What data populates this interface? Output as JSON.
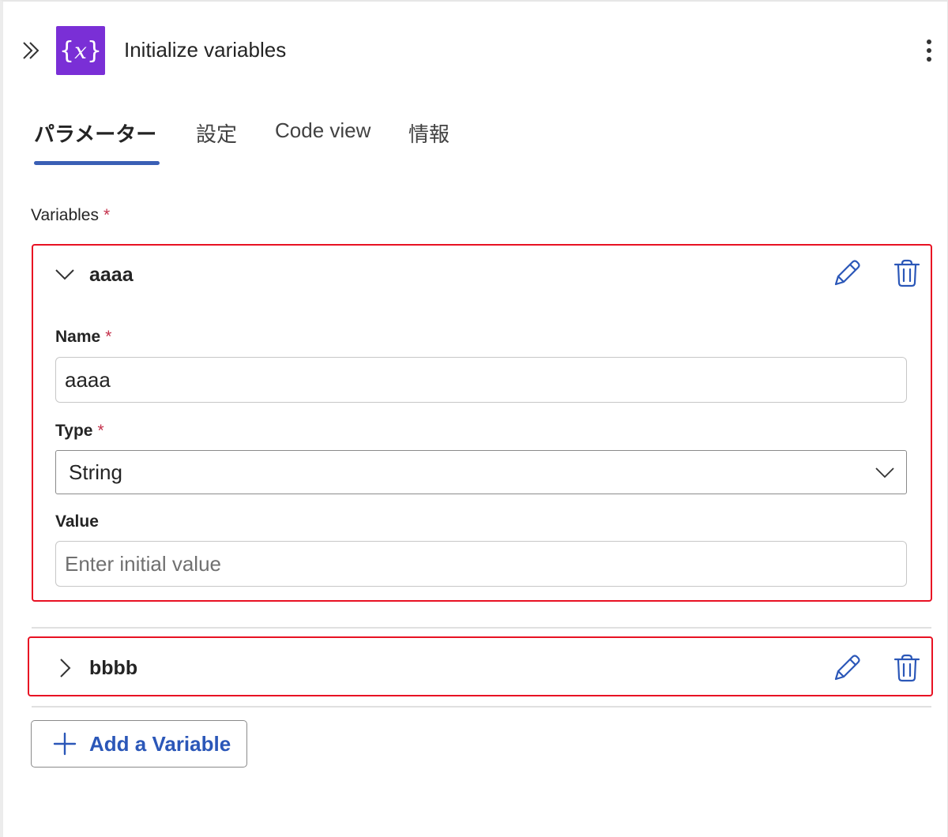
{
  "header": {
    "title": "Initialize variables",
    "icon_text": "x"
  },
  "tabs": [
    {
      "label": "パラメーター",
      "active": true
    },
    {
      "label": "設定",
      "active": false
    },
    {
      "label": "Code view",
      "active": false
    },
    {
      "label": "情報",
      "active": false
    }
  ],
  "variables_section": {
    "label": "Variables",
    "required_mark": "*"
  },
  "variables": [
    {
      "name": "aaaa",
      "expanded": true,
      "fields": {
        "name_label": "Name",
        "name_value": "aaaa",
        "type_label": "Type",
        "type_value": "String",
        "value_label": "Value",
        "value_placeholder": "Enter initial value"
      }
    },
    {
      "name": "bbbb",
      "expanded": false
    }
  ],
  "add_button": {
    "label": "Add a Variable"
  },
  "colors": {
    "accent": "#3a5fb5",
    "icon_bg": "#7a2fd6",
    "highlight_border": "#e81123",
    "required": "#c4314b",
    "link": "#2b57b8"
  },
  "icons": [
    "double-chevron-right-icon",
    "variable-icon",
    "more-vertical-icon",
    "chevron-down-icon",
    "chevron-right-icon",
    "pencil-icon",
    "trash-icon",
    "plus-icon"
  ]
}
